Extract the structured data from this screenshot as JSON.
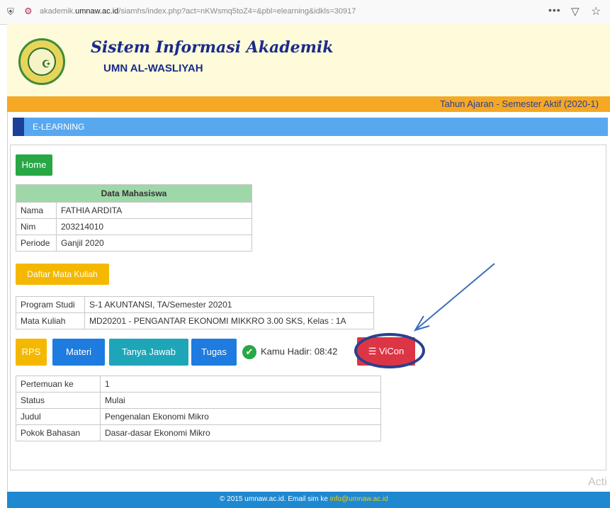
{
  "browser": {
    "url_prefix": "akademik.",
    "url_domain": "umnaw.ac.id",
    "url_path": "/siamhs/index.php?act=nKWsmq5toZ4=&pbl=elearning&idkls=30917",
    "menu_icon": "more-dots-icon",
    "pocket_icon": "pocket-icon",
    "bookmark_icon": "star-icon"
  },
  "header": {
    "title": "Sistem Informasi Akademik",
    "subtitle": "UMN AL-WASLIYAH",
    "semester": "Tahun Ajaran - Semester Aktif (2020-1)"
  },
  "section": {
    "label": "E-LEARNING"
  },
  "buttons": {
    "home": "Home",
    "daftar_mata_kuliah": "Daftar Mata Kuliah",
    "rps": "RPS",
    "materi": "Materi",
    "tanya_jawab": "Tanya Jawab",
    "tugas": "Tugas",
    "vicon": "ViCon"
  },
  "attendance": {
    "text": "Kamu Hadir: 08:42"
  },
  "mahasiswa": {
    "heading": "Data Mahasiswa",
    "rows": [
      {
        "label": "Nama",
        "value": "FATHIA ARDITA"
      },
      {
        "label": "Nim",
        "value": "203214010"
      },
      {
        "label": "Periode",
        "value": "Ganjil 2020"
      }
    ]
  },
  "kuliah": {
    "rows": [
      {
        "label": "Program Studi",
        "value": "S-1 AKUNTANSI, TA/Semester 20201"
      },
      {
        "label": "Mata Kuliah",
        "value": "MD20201 - PENGANTAR EKONOMI MIKKRO 3.00 SKS, Kelas : 1A"
      }
    ]
  },
  "pertemuan": {
    "rows": [
      {
        "label": "Pertemuan ke",
        "value": "1"
      },
      {
        "label": "Status",
        "value": "Mulai"
      },
      {
        "label": "Judul",
        "value": "Pengenalan Ekonomi Mikro"
      },
      {
        "label": "Pokok Bahasan",
        "value": "Dasar-dasar Ekonomi Mikro"
      }
    ]
  },
  "footer": {
    "text": "© 2015 umnaw.ac.id. Email sim ke",
    "email": "info@umnaw.ac.id"
  },
  "watermark": "Acti",
  "colors": {
    "header_bg": "#fdfbd9",
    "orange": "#f5a823",
    "blue": "#58a8f0",
    "vicon": "#dc3545"
  }
}
